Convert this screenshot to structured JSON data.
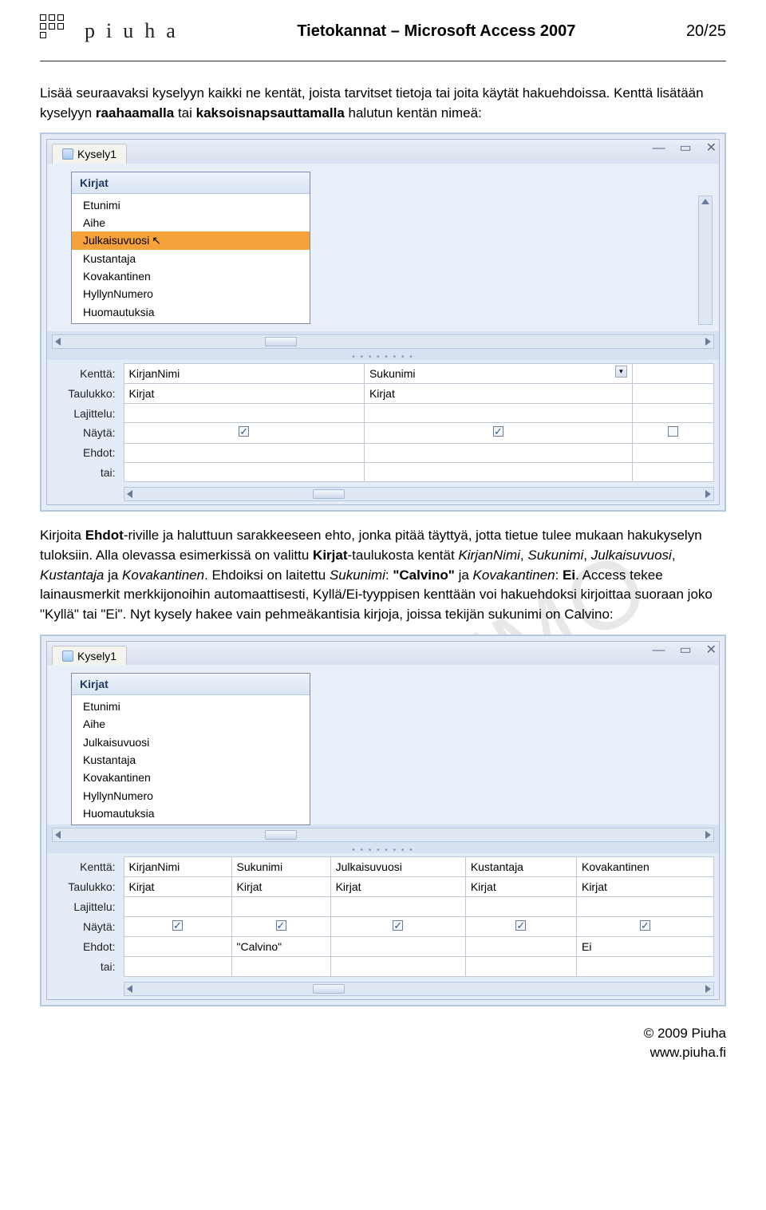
{
  "header": {
    "logo_text": "piuha",
    "doc_title": "Tietokannat – Microsoft Access 2007",
    "page": "20/25"
  },
  "para1_a": "Lisää seuraavaksi kyselyyn kaikki ne kentät, joista tarvitset tietoja tai joita käytät hakuehdoissa. Kenttä lisätään kyselyyn ",
  "para1_b": "raahaamalla",
  "para1_c": " tai ",
  "para1_d": "kaksoisnapsauttamalla",
  "para1_e": " halutun kentän nimeä:",
  "screenshot1": {
    "tab_label": "Kysely1",
    "listbox_title": "Kirjat",
    "fields": [
      "Etunimi",
      "Aihe",
      "Julkaisuvuosi",
      "Kustantaja",
      "Kovakantinen",
      "HyllynNumero",
      "Huomautuksia"
    ],
    "selected_index": 2,
    "row_labels": [
      "Kenttä:",
      "Taulukko:",
      "Lajittelu:",
      "Näytä:",
      "Ehdot:",
      "tai:"
    ],
    "cols": [
      {
        "field": "KirjanNimi",
        "table": "Kirjat",
        "show": true,
        "criteria": "",
        "dd": false
      },
      {
        "field": "Sukunimi",
        "table": "Kirjat",
        "show": true,
        "criteria": "",
        "dd": true
      }
    ]
  },
  "para2_a": "Kirjoita ",
  "para2_b": "Ehdot",
  "para2_c": "-riville ja haluttuun sarakkeeseen ehto, jonka pitää täyttyä, jotta tietue tulee mukaan hakukyselyn tuloksiin. Alla olevassa esimerkissä on valittu ",
  "para2_d": "Kirjat",
  "para2_e": "-taulukosta kentät ",
  "para2_f": "KirjanNimi",
  "para2_g": ", ",
  "para2_h": "Sukunimi",
  "para2_i": ", ",
  "para2_j": "Julkaisuvuosi",
  "para2_k": ", ",
  "para2_l": "Kustantaja",
  "para2_m": " ja ",
  "para2_n": "Kovakantinen",
  "para2_o": ". Ehdoiksi on laitettu ",
  "para2_p": "Sukunimi",
  "para2_q": ": ",
  "para2_r": "\"Calvino\"",
  "para2_s": " ja ",
  "para2_t": "Kovakantinen",
  "para2_u": ": ",
  "para2_v": "Ei",
  "para2_w": ". Access tekee lainausmerkit merkkijonoihin automaattisesti, Kyllä/Ei-tyyppisen kenttään voi hakuehdoksi kirjoittaa suoraan joko \"Kyllä\" tai \"Ei\". Nyt kysely hakee vain pehmeäkantisia kirjoja, joissa tekijän sukunimi on Calvino:",
  "screenshot2": {
    "tab_label": "Kysely1",
    "listbox_title": "Kirjat",
    "fields": [
      "Etunimi",
      "Aihe",
      "Julkaisuvuosi",
      "Kustantaja",
      "Kovakantinen",
      "HyllynNumero",
      "Huomautuksia"
    ],
    "row_labels": [
      "Kenttä:",
      "Taulukko:",
      "Lajittelu:",
      "Näytä:",
      "Ehdot:",
      "tai:"
    ],
    "cols": [
      {
        "field": "KirjanNimi",
        "table": "Kirjat",
        "show": true,
        "criteria": ""
      },
      {
        "field": "Sukunimi",
        "table": "Kirjat",
        "show": true,
        "criteria": "\"Calvino\""
      },
      {
        "field": "Julkaisuvuosi",
        "table": "Kirjat",
        "show": true,
        "criteria": ""
      },
      {
        "field": "Kustantaja",
        "table": "Kirjat",
        "show": true,
        "criteria": ""
      },
      {
        "field": "Kovakantinen",
        "table": "Kirjat",
        "show": true,
        "criteria": "Ei"
      }
    ]
  },
  "watermark": "DEMO",
  "footer_line1": "© 2009 Piuha",
  "footer_line2": "www.piuha.fi"
}
